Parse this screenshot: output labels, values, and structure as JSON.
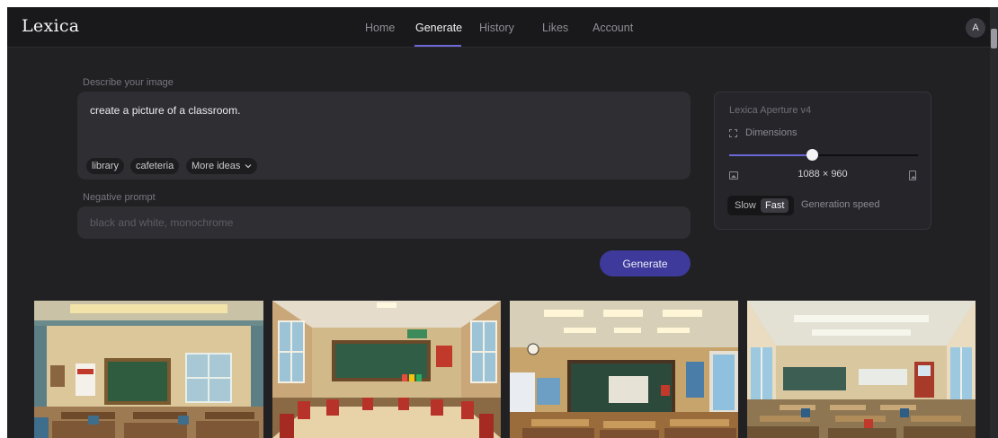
{
  "app": {
    "logo": "Lexica"
  },
  "nav": {
    "items": [
      {
        "label": "Home",
        "active": false
      },
      {
        "label": "Generate",
        "active": true
      },
      {
        "label": "History",
        "active": false
      },
      {
        "label": "Likes",
        "active": false
      },
      {
        "label": "Account",
        "active": false
      }
    ],
    "avatar_letter": "A"
  },
  "prompt": {
    "label": "Describe your image",
    "value": "create a picture of a classroom.",
    "chips": [
      "library",
      "cafeteria"
    ],
    "more_ideas": "More ideas",
    "more_ideas_icon": "chevron-down-icon"
  },
  "negative": {
    "label": "Negative prompt",
    "placeholder": "black and white, monochrome"
  },
  "generate_button": "Generate",
  "settings": {
    "model": "Lexica Aperture v4",
    "dimensions_label": "Dimensions",
    "dimensions_icon": "crop-frame-icon",
    "dimensions_value": "1088 × 960",
    "slider_level": 0.44,
    "landscape_icon": "landscape-image-icon",
    "portrait_icon": "portrait-image-icon",
    "speed_options": [
      "Slow",
      "Fast"
    ],
    "speed_selected": "Fast",
    "speed_label": "Generation speed"
  },
  "results": {
    "count": 4,
    "subject": "classroom"
  },
  "colors": {
    "accent": "#6e6ad8",
    "button": "#3e3a9c",
    "background": "#212124",
    "input": "#2e2e33",
    "chalkboard": "#2f5b3f",
    "desk_red": "#b7332a"
  }
}
